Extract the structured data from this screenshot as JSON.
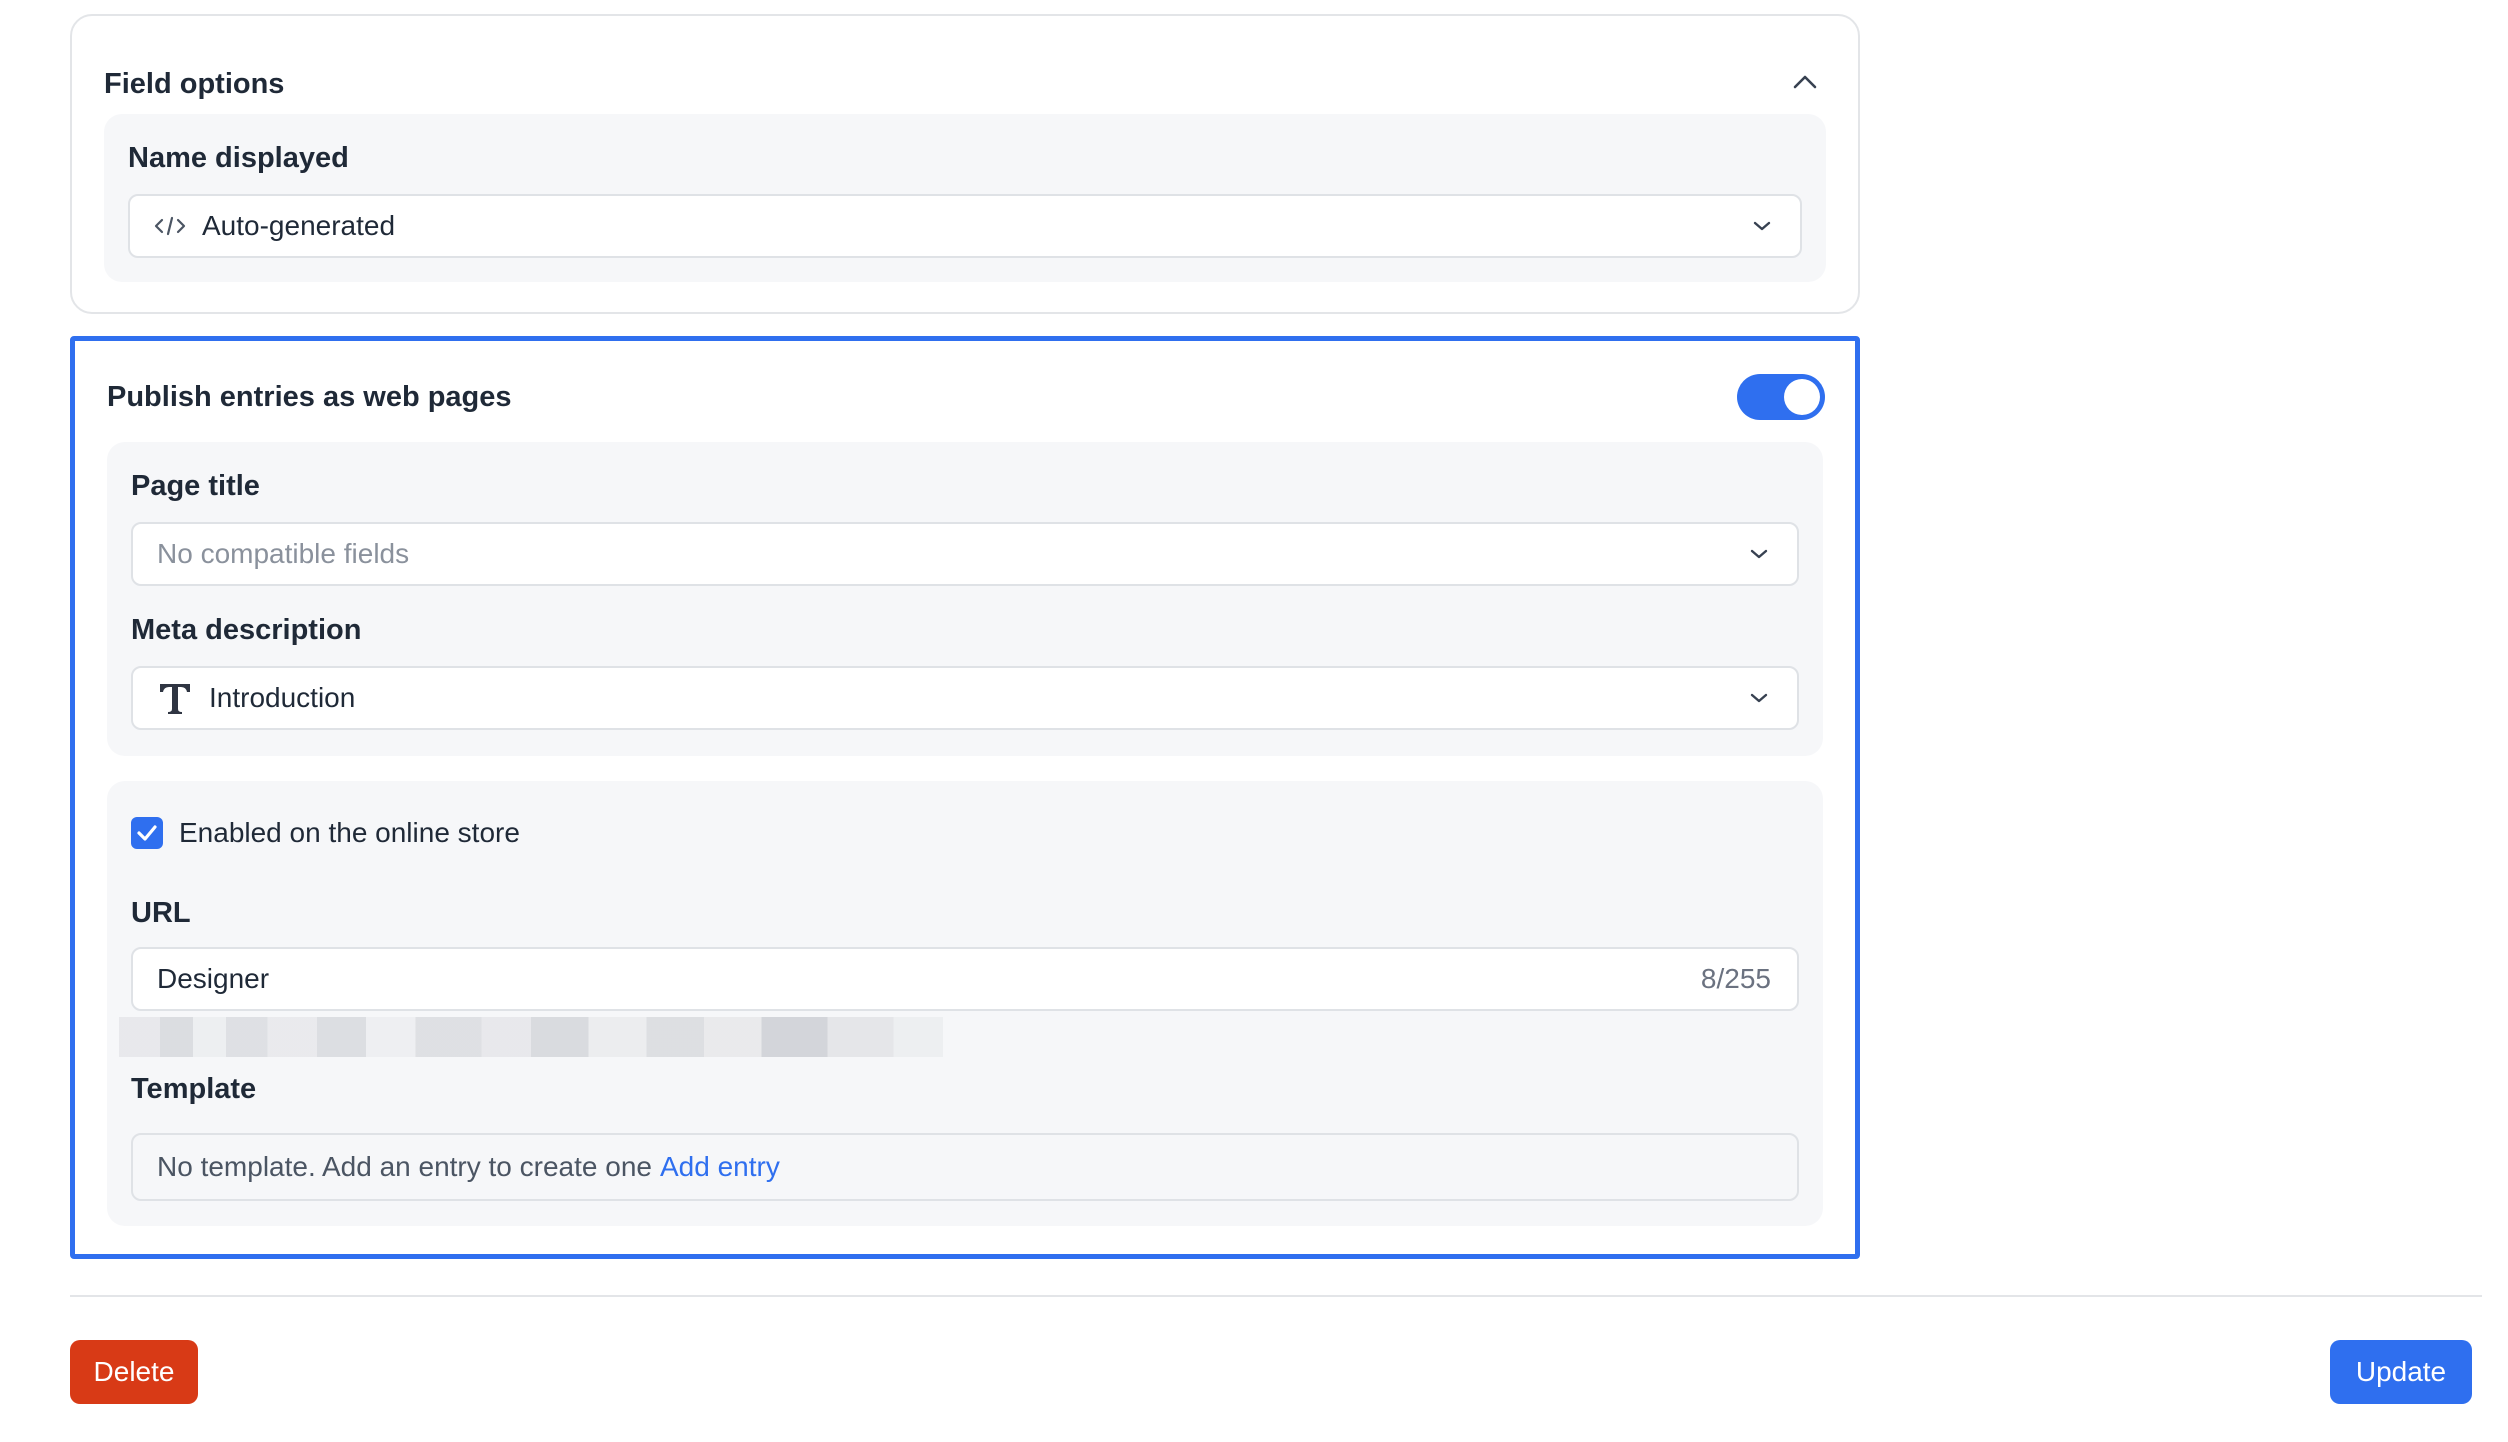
{
  "field_options": {
    "title": "Field options",
    "name_displayed": {
      "label": "Name displayed",
      "value": "Auto-generated",
      "icon": "code-icon"
    }
  },
  "publish": {
    "title": "Publish entries as web pages",
    "toggle_on": true,
    "page_title": {
      "label": "Page title",
      "placeholder": "No compatible fields"
    },
    "meta_description": {
      "label": "Meta description",
      "value": "Introduction",
      "icon": "text-type-icon"
    },
    "online_store": {
      "checkbox_label": "Enabled on the online store",
      "checked": true
    },
    "url": {
      "label": "URL",
      "value": "Designer",
      "counter": "8/255"
    },
    "template": {
      "label": "Template",
      "text": "No template. Add an entry to create one",
      "link": "Add entry"
    }
  },
  "footer": {
    "delete_label": "Delete",
    "update_label": "Update"
  },
  "colors": {
    "accent": "#2f6fef",
    "danger": "#d83a16"
  }
}
